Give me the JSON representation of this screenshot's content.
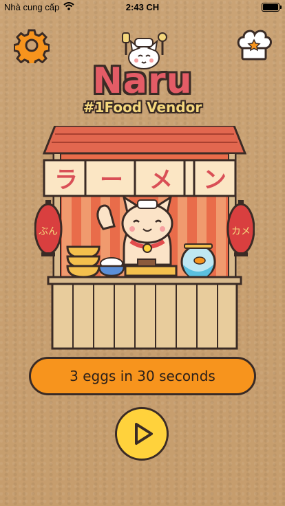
{
  "status_bar": {
    "carrier": "Nhà cung cấp",
    "time": "2:43 CH",
    "battery_level": 1.0
  },
  "header": {
    "settings_icon": "gear-icon",
    "recipes_icon": "chef-hat-icon",
    "title": "Naru",
    "subtitle": "#1Food Vendor"
  },
  "stall": {
    "curtain_text": [
      "ラ",
      "ー",
      "メ",
      "ン"
    ],
    "lantern_left_text": "ぶん",
    "lantern_right_text": "カメ"
  },
  "challenge": {
    "label": "3 eggs in 30 seconds"
  },
  "play_button": {
    "icon": "play-icon"
  },
  "colors": {
    "background": "#c9a173",
    "title": "#e45c66",
    "subtitle": "#f4d77d",
    "pill": "#f7941d",
    "play": "#ffd23c",
    "outline": "#3a2b25"
  }
}
